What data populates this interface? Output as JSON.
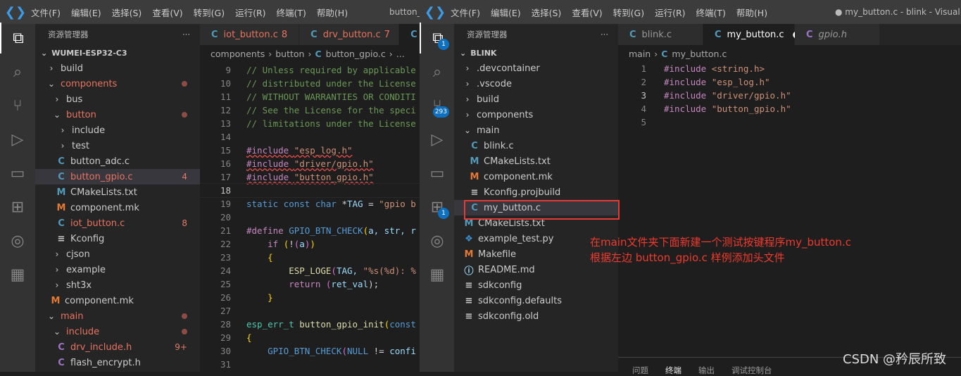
{
  "left": {
    "menu": [
      "文件(F)",
      "编辑(E)",
      "选择(S)",
      "查看(V)",
      "转到(G)",
      "运行(R)",
      "终端(T)",
      "帮助(H)"
    ],
    "window_title": "button_",
    "explorer_title": "资源管理器",
    "more": "···",
    "root": "WUMEI-ESP32-C3",
    "tree": [
      {
        "label": "build",
        "kind": "folder",
        "open": false,
        "level": 0
      },
      {
        "label": "components",
        "kind": "folder",
        "open": true,
        "level": 0,
        "red": true,
        "dot": true
      },
      {
        "label": "bus",
        "kind": "folder",
        "open": false,
        "level": 1
      },
      {
        "label": "button",
        "kind": "folder",
        "open": true,
        "level": 1,
        "red": true,
        "dot": true
      },
      {
        "label": "include",
        "kind": "folder",
        "open": false,
        "level": 2
      },
      {
        "label": "test",
        "kind": "folder",
        "open": false,
        "level": 2
      },
      {
        "label": "button_adc.c",
        "kind": "c",
        "level": 2
      },
      {
        "label": "button_gpio.c",
        "kind": "c",
        "level": 2,
        "red": true,
        "badge": "4",
        "selected": true
      },
      {
        "label": "CMakeLists.txt",
        "kind": "cmake",
        "level": 2
      },
      {
        "label": "component.mk",
        "kind": "make",
        "level": 2
      },
      {
        "label": "iot_button.c",
        "kind": "c",
        "level": 2,
        "red": true,
        "badge": "8"
      },
      {
        "label": "Kconfig",
        "kind": "text",
        "level": 2
      },
      {
        "label": "cjson",
        "kind": "folder",
        "open": false,
        "level": 1
      },
      {
        "label": "example",
        "kind": "folder",
        "open": false,
        "level": 1
      },
      {
        "label": "sht3x",
        "kind": "folder",
        "open": false,
        "level": 1
      },
      {
        "label": "component.mk",
        "kind": "make",
        "level": 1
      },
      {
        "label": "main",
        "kind": "folder",
        "open": true,
        "level": 0,
        "red": true,
        "dot": true
      },
      {
        "label": "include",
        "kind": "folder",
        "open": true,
        "level": 1,
        "red": true,
        "dot": true
      },
      {
        "label": "drv_include.h",
        "kind": "h",
        "level": 2,
        "red": true,
        "badge": "9+"
      },
      {
        "label": "flash_encrypt.h",
        "kind": "h",
        "level": 2
      }
    ],
    "tabs": [
      {
        "label": "iot_button.c",
        "badge": "8",
        "red": true
      },
      {
        "label": "drv_button.c",
        "badge": "7",
        "red": true
      },
      {
        "label": "",
        "active": true
      }
    ],
    "breadcrumb": [
      "components",
      "button",
      "button_gpio.c",
      "..."
    ],
    "code": [
      {
        "n": "9",
        "t": [
          [
            "// Unless required by applicable",
            "cm"
          ]
        ]
      },
      {
        "n": "10",
        "t": [
          [
            "// distributed under the License",
            "cm"
          ]
        ]
      },
      {
        "n": "11",
        "t": [
          [
            "// WITHOUT WARRANTIES OR CONDITI",
            "cm"
          ]
        ]
      },
      {
        "n": "12",
        "t": [
          [
            "// See the License for the speci",
            "cm"
          ]
        ]
      },
      {
        "n": "13",
        "t": [
          [
            "// limitations under the License",
            "cm"
          ]
        ]
      },
      {
        "n": "14",
        "t": []
      },
      {
        "n": "15",
        "t": [
          [
            "#include ",
            "pp sq"
          ],
          [
            "\"esp_log.h\"",
            "st sq"
          ]
        ]
      },
      {
        "n": "16",
        "t": [
          [
            "#include ",
            "pp sq"
          ],
          [
            "\"driver/gpio.h\"",
            "st sq"
          ]
        ]
      },
      {
        "n": "17",
        "t": [
          [
            "#include ",
            "pp sq"
          ],
          [
            "\"button_gpio.h\"",
            "st sq"
          ]
        ]
      },
      {
        "n": "18",
        "t": [],
        "current": true
      },
      {
        "n": "19",
        "t": [
          [
            "static const char ",
            "kw"
          ],
          [
            "*",
            "pl"
          ],
          [
            "TAG",
            "id"
          ],
          [
            " = ",
            "pl"
          ],
          [
            "\"gpio b",
            "st"
          ]
        ]
      },
      {
        "n": "20",
        "t": []
      },
      {
        "n": "21",
        "t": [
          [
            "#define ",
            "pp"
          ],
          [
            "GPIO_BTN_CHECK",
            "kw"
          ],
          [
            "(",
            "br"
          ],
          [
            "a, str, r",
            "id"
          ]
        ]
      },
      {
        "n": "22",
        "t": [
          [
            "    if ",
            "pp"
          ],
          [
            "(",
            "br"
          ],
          [
            "!",
            "pl"
          ],
          [
            "(",
            "br2"
          ],
          [
            "a",
            "id"
          ],
          [
            ")",
            "br2"
          ],
          [
            ")",
            "br"
          ]
        ]
      },
      {
        "n": "23",
        "t": [
          [
            "    {",
            "br"
          ]
        ]
      },
      {
        "n": "24",
        "t": [
          [
            "        ESP_LOGE",
            "fn"
          ],
          [
            "(",
            "br2"
          ],
          [
            "TAG, ",
            "id"
          ],
          [
            "\"%s(%d): %",
            "st"
          ]
        ]
      },
      {
        "n": "25",
        "t": [
          [
            "        return ",
            "pp"
          ],
          [
            "(",
            "br2"
          ],
          [
            "ret_val",
            "id"
          ],
          [
            ");",
            "pl"
          ]
        ]
      },
      {
        "n": "26",
        "t": [
          [
            "    }",
            "br"
          ]
        ]
      },
      {
        "n": "27",
        "t": []
      },
      {
        "n": "28",
        "t": [
          [
            "esp_err_t ",
            "ty"
          ],
          [
            "button_gpio_init",
            "fn"
          ],
          [
            "(",
            "br"
          ],
          [
            "const",
            "kw"
          ]
        ]
      },
      {
        "n": "29",
        "t": [
          [
            "{",
            "br"
          ]
        ]
      },
      {
        "n": "30",
        "t": [
          [
            "    GPIO_BTN_CHECK",
            "kw"
          ],
          [
            "(",
            "br2"
          ],
          [
            "NULL",
            "kw"
          ],
          [
            " != ",
            "pl"
          ],
          [
            "confi",
            "id"
          ]
        ]
      },
      {
        "n": "31",
        "t": []
      }
    ]
  },
  "right": {
    "menu": [
      "文件(F)",
      "编辑(E)",
      "选择(S)",
      "查看(V)",
      "转到(G)",
      "运行(R)",
      "终端(T)",
      "帮助(H)"
    ],
    "window_title": "● my_button.c - blink - Visual Stu",
    "explorer_title": "资源管理器",
    "more": "···",
    "root": "BLINK",
    "activity_badges": {
      "explorer": "1",
      "scm": "293",
      "extensions": "1"
    },
    "tree": [
      {
        "label": ".devcontainer",
        "kind": "folder",
        "open": false,
        "level": 0
      },
      {
        "label": ".vscode",
        "kind": "folder",
        "open": false,
        "level": 0
      },
      {
        "label": "build",
        "kind": "folder",
        "open": false,
        "level": 0
      },
      {
        "label": "components",
        "kind": "folder",
        "open": false,
        "level": 0
      },
      {
        "label": "main",
        "kind": "folder",
        "open": true,
        "level": 0
      },
      {
        "label": "blink.c",
        "kind": "c",
        "level": 1
      },
      {
        "label": "CMakeLists.txt",
        "kind": "cmake",
        "level": 1
      },
      {
        "label": "component.mk",
        "kind": "make",
        "level": 1
      },
      {
        "label": "Kconfig.projbuild",
        "kind": "text",
        "level": 1
      },
      {
        "label": "my_button.c",
        "kind": "c",
        "level": 1,
        "selected": true
      },
      {
        "label": "CMakeLists.txt",
        "kind": "cmake",
        "level": 0
      },
      {
        "label": "example_test.py",
        "kind": "py",
        "level": 0
      },
      {
        "label": "Makefile",
        "kind": "make",
        "level": 0
      },
      {
        "label": "README.md",
        "kind": "info",
        "level": 0
      },
      {
        "label": "sdkconfig",
        "kind": "text",
        "level": 0
      },
      {
        "label": "sdkconfig.defaults",
        "kind": "text",
        "level": 0
      },
      {
        "label": "sdkconfig.old",
        "kind": "text",
        "level": 0
      }
    ],
    "tabs": [
      {
        "label": "blink.c"
      },
      {
        "label": "my_button.c",
        "active": true,
        "dirty": true
      },
      {
        "label": "gpio.h",
        "italic": true,
        "kind": "h"
      }
    ],
    "breadcrumb": [
      "main",
      "my_button.c"
    ],
    "code": [
      {
        "n": "1",
        "t": [
          [
            "#include ",
            "pp"
          ],
          [
            "<string.h>",
            "st"
          ]
        ]
      },
      {
        "n": "2",
        "t": [
          [
            "#include ",
            "pp"
          ],
          [
            "\"esp_log.h\"",
            "st"
          ]
        ]
      },
      {
        "n": "3",
        "t": [
          [
            "#include ",
            "pp"
          ],
          [
            "\"driver/gpio.h\"",
            "st"
          ]
        ],
        "current": true
      },
      {
        "n": "4",
        "t": [
          [
            "#include ",
            "pp"
          ],
          [
            "\"button_gpio.h\"",
            "st"
          ]
        ]
      },
      {
        "n": "5",
        "t": []
      }
    ],
    "panel_tabs": [
      "问题",
      "终端",
      "输出",
      "调试控制台"
    ],
    "panel_active": 1
  },
  "annotation": [
    "在main文件夹下面新建一个测试按键程序my_button.c",
    "根据左边 button_gpio.c 样例添加头文件"
  ],
  "watermark": "CSDN @矜辰所致"
}
